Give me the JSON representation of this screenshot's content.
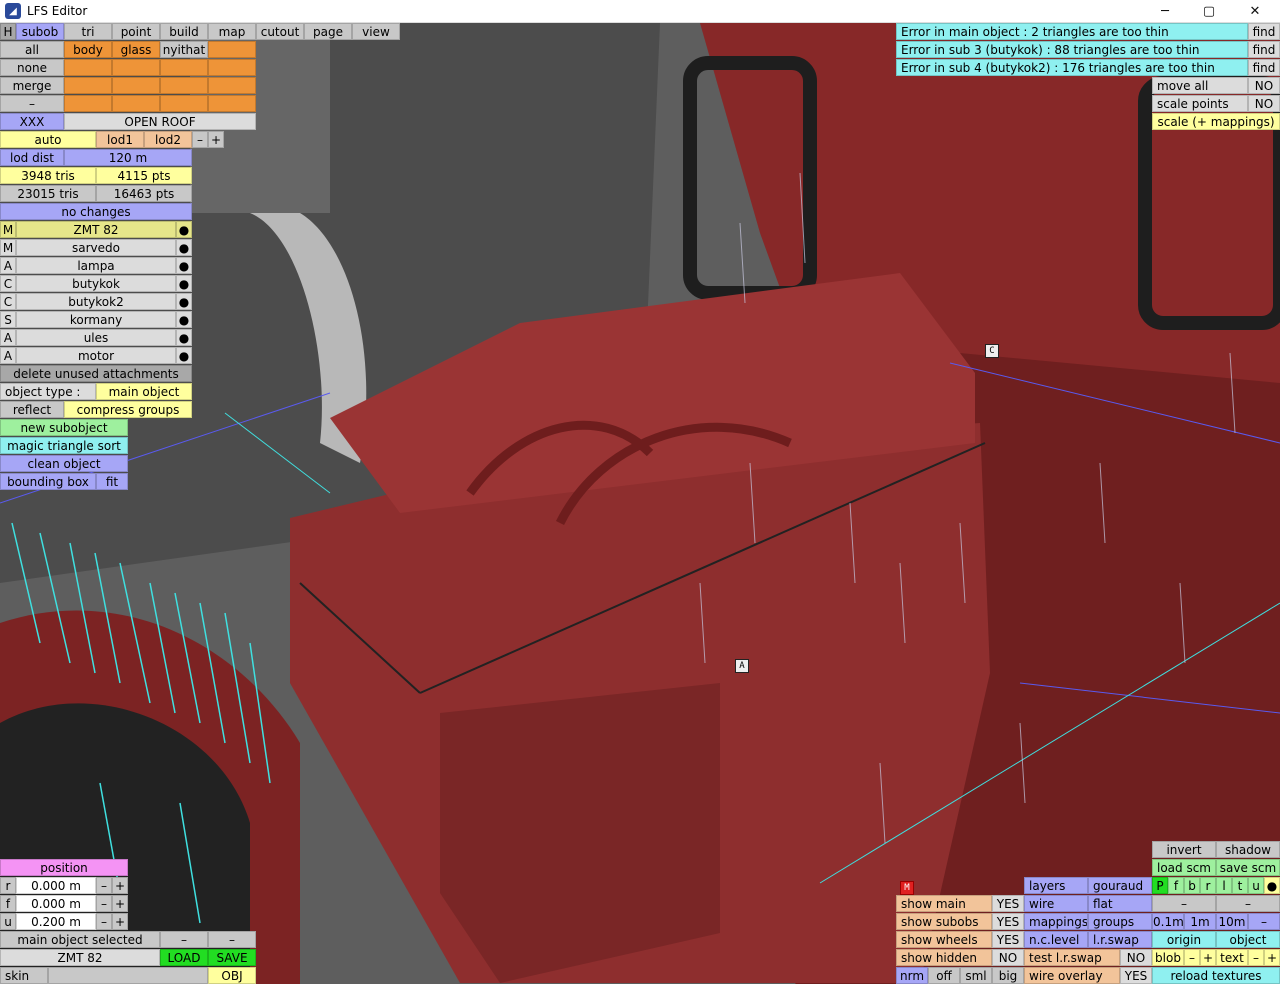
{
  "window": {
    "title": "LFS Editor",
    "min": "─",
    "max": "▢",
    "close": "✕",
    "icon_name": "lfs-app-icon"
  },
  "menu": {
    "h": "H",
    "items": [
      "subob",
      "tri",
      "point",
      "build",
      "map",
      "cutout",
      "page",
      "view"
    ]
  },
  "groups": {
    "all": "all",
    "none": "none",
    "merge": "merge",
    "dash": "–",
    "slots": [
      "body",
      "glass",
      "nyithat"
    ]
  },
  "xxx": "XXX",
  "open_roof": "OPEN ROOF",
  "lod": {
    "auto": "auto",
    "lod1": "lod1",
    "lod2": "lod2",
    "minus": "–",
    "plus": "+",
    "dist_label": "lod dist",
    "dist_value": "120 m",
    "tris1": "3948 tris",
    "pts1": "4115 pts",
    "tris2": "23015 tris",
    "pts2": "16463 pts"
  },
  "no_changes": "no changes",
  "subobjects": [
    {
      "type": "M",
      "name": "ZMT 82"
    },
    {
      "type": "M",
      "name": "sarvedo"
    },
    {
      "type": "A",
      "name": "lampa"
    },
    {
      "type": "C",
      "name": "butykok"
    },
    {
      "type": "C",
      "name": "butykok2"
    },
    {
      "type": "S",
      "name": "kormany"
    },
    {
      "type": "A",
      "name": "ules"
    },
    {
      "type": "A",
      "name": "motor"
    }
  ],
  "dot": "●",
  "delete_unused": "delete unused attachments",
  "object_type_label": "object type :",
  "object_type_value": "main object",
  "reflect": "reflect",
  "compress_groups": "compress groups",
  "new_subobject": "new subobject",
  "magic_sort": "magic triangle sort",
  "clean_object": "clean object",
  "bounding_box": "bounding box",
  "fit": "fit",
  "errors": [
    {
      "text": "Error in main object : 2 triangles are too thin",
      "action": "find"
    },
    {
      "text": "Error in sub 3 (butykok) : 88 triangles are too thin",
      "action": "find"
    },
    {
      "text": "Error in sub 4 (butykok2) : 176 triangles are too thin",
      "action": "find"
    }
  ],
  "scale_panel": {
    "move_all": "move all",
    "move_all_val": "NO",
    "scale_points": "scale points",
    "scale_points_val": "NO",
    "scale_mappings": "scale (+ mappings)"
  },
  "markers": {
    "c": "C",
    "a": "A",
    "m": "M"
  },
  "position": {
    "title": "position",
    "rows": [
      {
        "axis": "r",
        "value": "0.000 m"
      },
      {
        "axis": "f",
        "value": "0.000 m"
      },
      {
        "axis": "u",
        "value": "0.200 m"
      }
    ],
    "minus": "–",
    "plus": "+"
  },
  "bottom_left": {
    "selected": "main object selected",
    "minus": "–",
    "name": "ZMT 82",
    "load": "LOAD",
    "save": "SAVE",
    "skin": "skin",
    "obj": "OBJ"
  },
  "display": {
    "show_main": "show main",
    "show_main_val": "YES",
    "show_subobs": "show subobs",
    "show_subobs_val": "YES",
    "show_wheels": "show wheels",
    "show_wheels_val": "YES",
    "show_hidden": "show hidden",
    "show_hidden_val": "NO",
    "nrm": "nrm",
    "off": "off",
    "sml": "sml",
    "big": "big",
    "wire_overlay": "wire overlay",
    "wire_overlay_val": "YES"
  },
  "view_opts": {
    "layers": "layers",
    "gouraud": "gouraud",
    "wire": "wire",
    "flat": "flat",
    "mappings": "mappings",
    "groups": "groups",
    "nclevel": "n.c.level",
    "lrswap": "l.r.swap",
    "test_lrswap": "test l.r.swap",
    "test_lrswap_val": "NO"
  },
  "right_tools": {
    "invert": "invert",
    "shadow": "shadow",
    "load_scm": "load scm",
    "save_scm": "save scm",
    "colors": [
      "P",
      "f",
      "b",
      "r",
      "l",
      "t",
      "u"
    ],
    "dot": "●",
    "dash": "–",
    "steps": [
      "0.1m",
      "1m",
      "10m"
    ],
    "origin": "origin",
    "object": "object",
    "blob": "blob",
    "text": "text",
    "reload_textures": "reload textures"
  },
  "colors": {
    "accent_blue": "#a6a6f6",
    "yellow": "#ffff9e",
    "orange": "#ee9438",
    "cyan": "#8ff0f0",
    "engine_red": "#8e2e2e",
    "error_bg": "#8ff0f0",
    "load_green": "#22dd22"
  }
}
